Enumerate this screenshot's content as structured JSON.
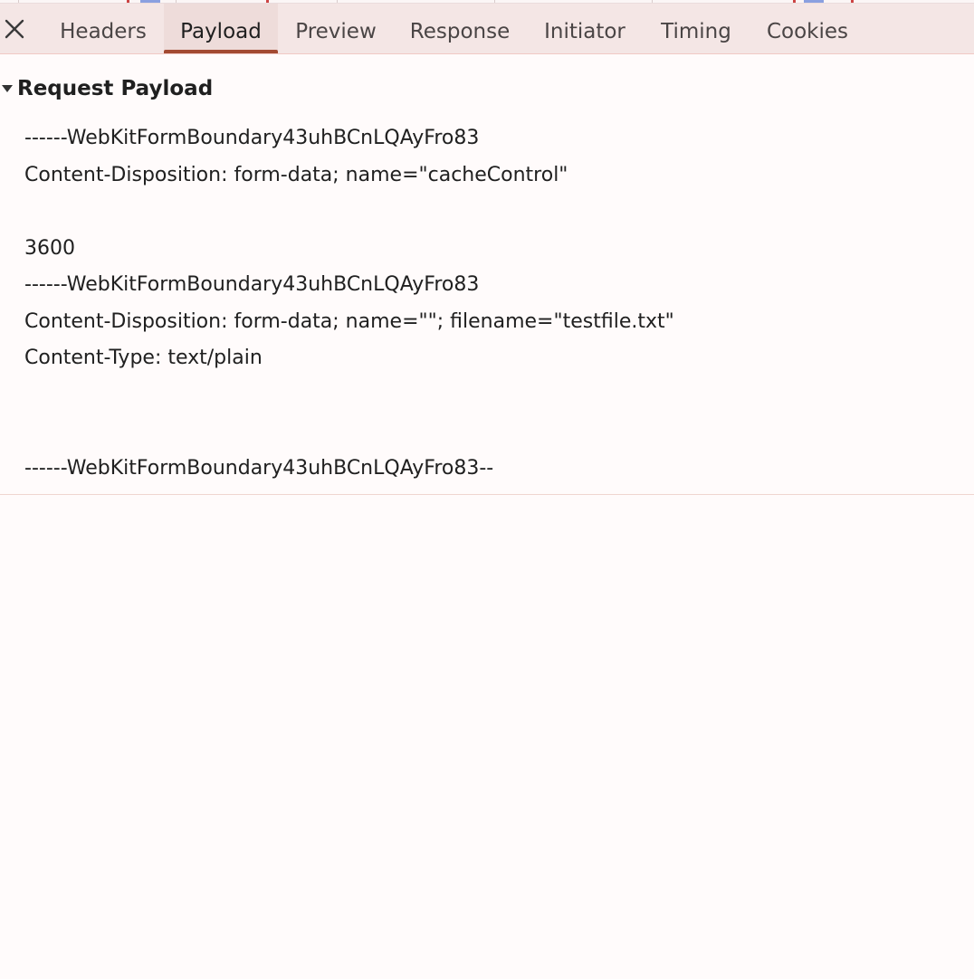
{
  "tabs": {
    "close_icon": "close-icon",
    "items": [
      {
        "label": "Headers",
        "active": false
      },
      {
        "label": "Payload",
        "active": true
      },
      {
        "label": "Preview",
        "active": false
      },
      {
        "label": "Response",
        "active": false
      },
      {
        "label": "Initiator",
        "active": false
      },
      {
        "label": "Timing",
        "active": false
      },
      {
        "label": "Cookies",
        "active": false
      }
    ]
  },
  "section": {
    "title": "Request Payload",
    "expanded": true,
    "lines": [
      "------WebKitFormBoundary43uhBCnLQAyFro83",
      "Content-Disposition: form-data; name=\"cacheControl\"",
      "",
      "3600",
      "------WebKitFormBoundary43uhBCnLQAyFro83",
      "Content-Disposition: form-data; name=\"\"; filename=\"testfile.txt\"",
      "Content-Type: text/plain",
      "",
      "",
      "------WebKitFormBoundary43uhBCnLQAyFro83--"
    ]
  },
  "colors": {
    "tabbar_bg": "#f4e6e5",
    "active_tab_bg": "#eedcda",
    "active_indicator": "#a34a32",
    "page_bg": "#fffbfb"
  }
}
